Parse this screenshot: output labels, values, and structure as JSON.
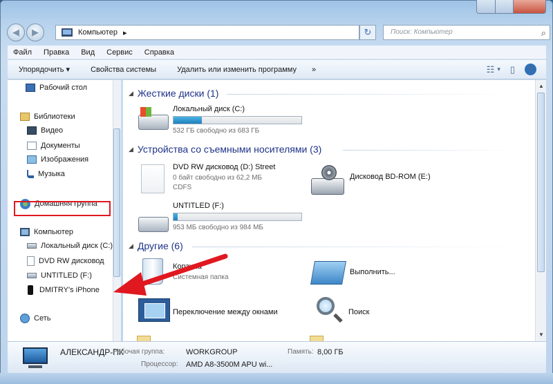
{
  "window": {
    "address": "Компьютер",
    "search_placeholder": "Поиск: Компьютер"
  },
  "menu": [
    "Файл",
    "Правка",
    "Вид",
    "Сервис",
    "Справка"
  ],
  "toolbar": {
    "organize": "Упорядочить",
    "properties": "Свойства системы",
    "uninstall": "Удалить или изменить программу",
    "more": "»"
  },
  "nav": {
    "desktop": "Рабочий стол",
    "libraries": "Библиотеки",
    "video": "Видео",
    "documents": "Документы",
    "images": "Изображения",
    "music": "Музыка",
    "homegroup": "Домашняя группа",
    "computer": "Компьютер",
    "local_disk": "Локальный диск (C:)",
    "dvd": "DVD RW дисковод",
    "untitled": "UNTITLED (F:)",
    "iphone": "DMITRY's iPhone",
    "network": "Сеть"
  },
  "groups": {
    "hdd": "Жесткие диски (1)",
    "removable": "Устройства со съемными носителями (3)",
    "other": "Другие (6)"
  },
  "items": {
    "c_drive": {
      "name": "Локальный диск (C:)",
      "info": "532 ГБ свободно из 683 ГБ",
      "fill": 0.22
    },
    "dvd": {
      "name": "DVD RW дисковод (D:) Street",
      "info": "0 байт свободно из 62,2 МБ",
      "fs": "CDFS"
    },
    "bdrom": {
      "name": "Дисковод BD-ROM (E:)"
    },
    "untitled": {
      "name": "UNTITLED (F:)",
      "info": "953 МБ свободно из 984 МБ",
      "fill": 0.03
    },
    "recycle": {
      "name": "Корзина",
      "info": "Системная папка"
    },
    "run": {
      "name": "Выполнить..."
    },
    "switch": {
      "name": "Переключение между окнами"
    },
    "search": {
      "name": "Поиск"
    }
  },
  "details": {
    "pc_name": "АЛЕКСАНДР-ПК",
    "workgroup_label": "Рабочая группа:",
    "workgroup": "WORKGROUP",
    "memory_label": "Память:",
    "memory": "8,00 ГБ",
    "cpu_label": "Процессор:",
    "cpu": "AMD A8-3500M APU wi..."
  }
}
